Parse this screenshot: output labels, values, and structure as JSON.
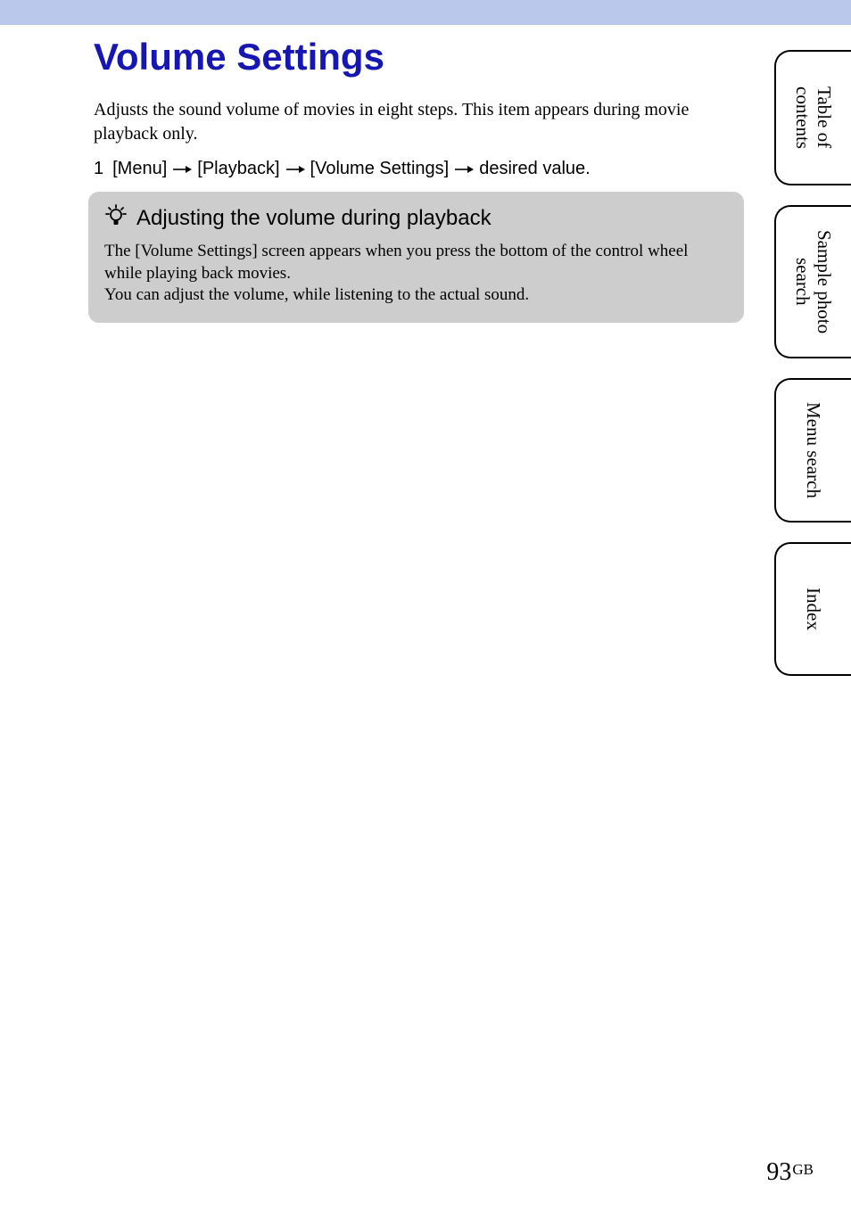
{
  "title": "Volume Settings",
  "intro": "Adjusts the sound volume of movies in eight steps. This item appears during movie playback only.",
  "step": {
    "num": "1",
    "p1": "[Menu]",
    "p2": "[Playback]",
    "p3": "[Volume Settings]",
    "p4": "desired value."
  },
  "tip": {
    "title": "Adjusting the volume during playback",
    "body1": "The [Volume Settings] screen appears when you press the bottom of the control wheel while playing back movies.",
    "body2": "You can adjust the volume, while listening to the actual sound."
  },
  "tabs": {
    "t1a": "Table of",
    "t1b": "contents",
    "t2a": "Sample photo",
    "t2b": "search",
    "t3": "Menu search",
    "t4": "Index"
  },
  "page": {
    "num": "93",
    "suffix": "GB"
  }
}
